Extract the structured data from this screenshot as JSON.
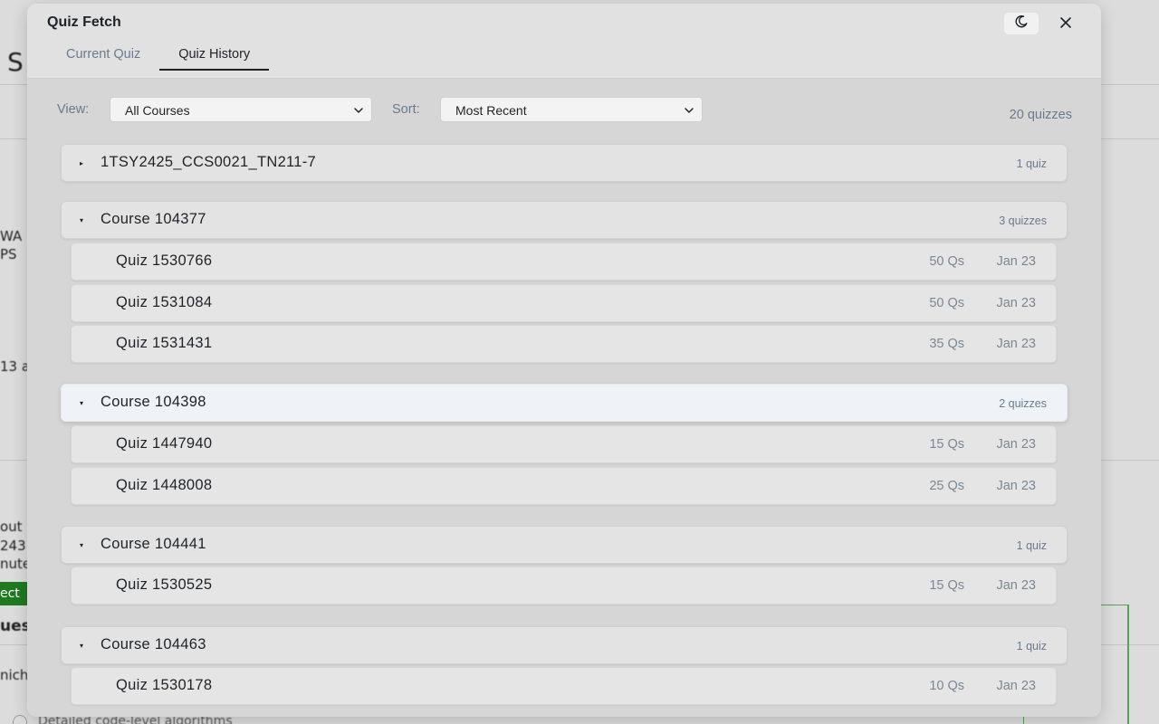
{
  "background": {
    "fragments": [
      "S",
      "WA",
      "PS",
      "13 a",
      "out",
      "243",
      "nute",
      "ues",
      "nich",
      "Detailed code-level algorithms"
    ],
    "button_label": "ect"
  },
  "modal": {
    "title": "Quiz Fetch",
    "tabs": [
      {
        "label": "Current Quiz",
        "active": false
      },
      {
        "label": "Quiz History",
        "active": true
      }
    ],
    "toolbar": {
      "view_label": "View:",
      "view_value": "All Courses",
      "sort_label": "Sort:",
      "sort_value": "Most Recent",
      "total_count": "20 quizzes"
    },
    "courses": [
      {
        "name": "1TSY2425_CCS0021_TN211-7",
        "count": "1 quiz",
        "expanded": false,
        "quizzes": []
      },
      {
        "name": "Course 104377",
        "count": "3 quizzes",
        "expanded": true,
        "quizzes": [
          {
            "name": "Quiz 1530766",
            "questions": "50 Qs",
            "date": "Jan 23"
          },
          {
            "name": "Quiz 1531084",
            "questions": "50 Qs",
            "date": "Jan 23"
          },
          {
            "name": "Quiz 1531431",
            "questions": "35 Qs",
            "date": "Jan 23"
          }
        ]
      },
      {
        "name": "Course 104398",
        "count": "2 quizzes",
        "expanded": true,
        "quizzes": [
          {
            "name": "Quiz 1447940",
            "questions": "15 Qs",
            "date": "Jan 23"
          },
          {
            "name": "Quiz 1448008",
            "questions": "25 Qs",
            "date": "Jan 23"
          }
        ]
      },
      {
        "name": "Course 104441",
        "count": "1 quiz",
        "expanded": true,
        "quizzes": [
          {
            "name": "Quiz 1530525",
            "questions": "15 Qs",
            "date": "Jan 23"
          }
        ]
      },
      {
        "name": "Course 104463",
        "count": "1 quiz",
        "expanded": true,
        "quizzes": [
          {
            "name": "Quiz 1530178",
            "questions": "10 Qs",
            "date": "Jan 23"
          }
        ]
      }
    ],
    "icons": {
      "theme": "moon-icon",
      "close": "close-icon",
      "collapsed": "triangle-right-icon",
      "expanded": "triangle-down-icon",
      "dropdown": "chevron-down-icon"
    }
  }
}
